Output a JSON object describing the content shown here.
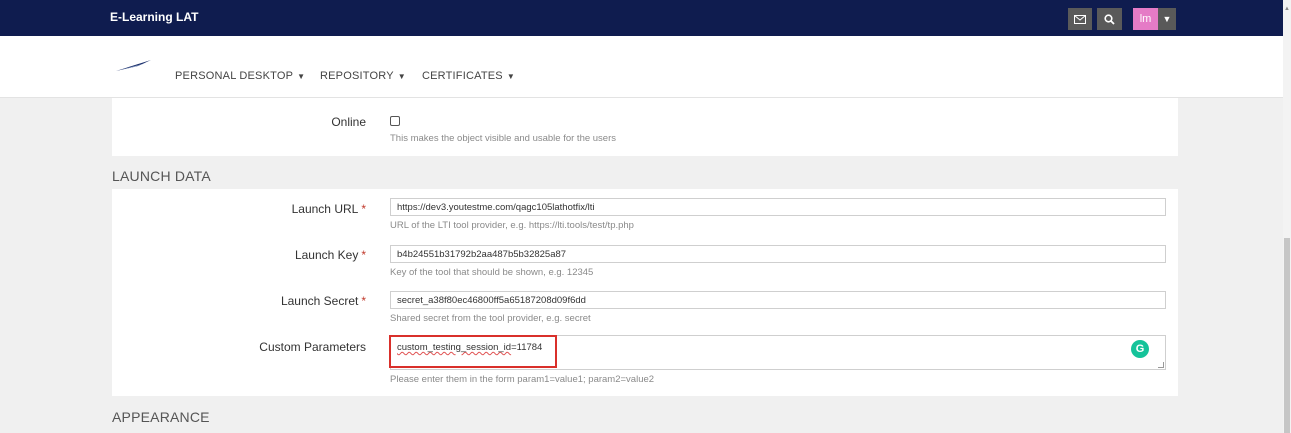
{
  "header": {
    "brand": "E-Learning LAT",
    "avatar_initials": "lm",
    "mail_icon": "envelope-icon",
    "search_icon": "magnifier-icon",
    "colors": {
      "bar": "#0f1c4f",
      "avatar": "#e57bc6"
    }
  },
  "nav": {
    "items": [
      {
        "label": "PERSONAL DESKTOP"
      },
      {
        "label": "REPOSITORY"
      },
      {
        "label": "CERTIFICATES"
      }
    ]
  },
  "availability": {
    "online_label": "Online",
    "online_checked": false,
    "online_help": "This makes the object visible and usable for the users"
  },
  "launch_data": {
    "title": "LAUNCH DATA",
    "url_label": "Launch URL",
    "url_value": "https://dev3.youtestme.com/qagc105lathotfix/lti",
    "url_help": "URL of the LTI tool provider, e.g. https://lti.tools/test/tp.php",
    "key_label": "Launch Key",
    "key_value": "b4b24551b31792b2aa487b5b32825a87",
    "key_help": "Key of the tool that should be shown, e.g. 12345",
    "secret_label": "Launch Secret",
    "secret_value": "secret_a38f80ec46800ff5a65187208d09f6dd",
    "secret_help": "Shared secret from the tool provider, e.g. secret",
    "custom_label": "Custom Parameters",
    "custom_value_word": "custom_testing_session_id",
    "custom_value_rest": "=11784",
    "custom_help": "Please enter them in the form param1=value1; param2=value2",
    "required_mark": "*"
  },
  "appearance": {
    "title": "APPEARANCE"
  }
}
